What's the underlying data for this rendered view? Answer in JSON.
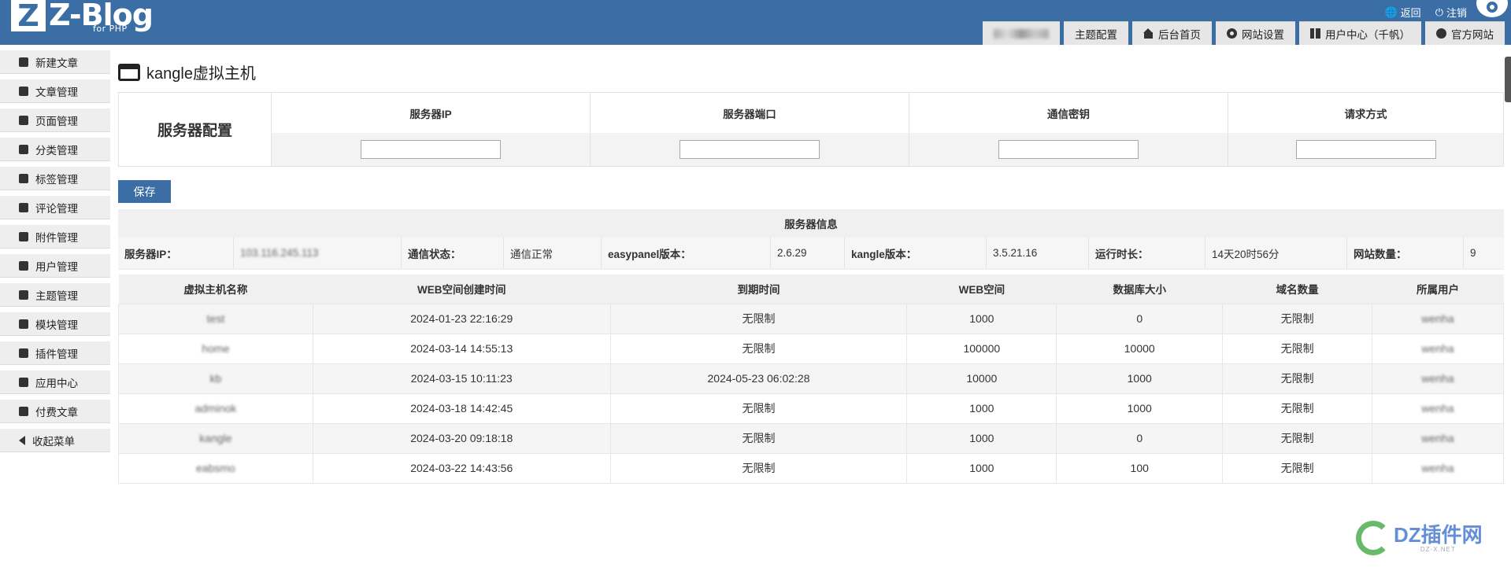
{
  "brand": {
    "logo_letter": "Z",
    "name": "Z-Blog",
    "sub": "for PHP"
  },
  "top_links": {
    "back": "返回",
    "logout": "注销"
  },
  "nav_tabs": [
    "主题配置",
    "后台首页",
    "网站设置",
    "用户中心（千帆）",
    "官方网站"
  ],
  "sidebar": [
    "新建文章",
    "文章管理",
    "页面管理",
    "分类管理",
    "标签管理",
    "评论管理",
    "附件管理",
    "用户管理",
    "主题管理",
    "模块管理",
    "插件管理",
    "应用中心",
    "付费文章",
    "收起菜单"
  ],
  "page_title": "kangle虚拟主机",
  "config": {
    "label": "服务器配置",
    "columns": [
      "服务器IP",
      "服务器端口",
      "通信密钥",
      "请求方式"
    ],
    "values": [
      "",
      "",
      "",
      ""
    ]
  },
  "save_label": "保存",
  "server_info": {
    "title": "服务器信息",
    "items": [
      {
        "k": "服务器IP：",
        "v": "103.116.245.113"
      },
      {
        "k": "通信状态：",
        "v": "通信正常"
      },
      {
        "k": "easypanel版本：",
        "v": "2.6.29"
      },
      {
        "k": "kangle版本：",
        "v": "3.5.21.16"
      },
      {
        "k": "运行时长：",
        "v": "14天20时56分"
      },
      {
        "k": "网站数量：",
        "v": "9"
      }
    ]
  },
  "hosts_table": {
    "headers": [
      "虚拟主机名称",
      "WEB空间创建时间",
      "到期时间",
      "WEB空间",
      "数据库大小",
      "域名数量",
      "所属用户"
    ],
    "rows": [
      [
        "test",
        "2024-01-23 22:16:29",
        "无限制",
        "1000",
        "0",
        "无限制",
        "wenha"
      ],
      [
        "home",
        "2024-03-14 14:55:13",
        "无限制",
        "100000",
        "10000",
        "无限制",
        "wenha"
      ],
      [
        "kb",
        "2024-03-15 10:11:23",
        "2024-05-23 06:02:28",
        "10000",
        "1000",
        "无限制",
        "wenha"
      ],
      [
        "adminok",
        "2024-03-18 14:42:45",
        "无限制",
        "1000",
        "1000",
        "无限制",
        "wenha"
      ],
      [
        "kangle",
        "2024-03-20 09:18:18",
        "无限制",
        "1000",
        "0",
        "无限制",
        "wenha"
      ],
      [
        "eabsmo",
        "2024-03-22 14:43:56",
        "无限制",
        "1000",
        "100",
        "无限制",
        "wenha"
      ]
    ]
  },
  "watermark": {
    "main": "DZ插件网",
    "sub": "DZ-X.NET"
  },
  "colors": {
    "brand": "#3a6ea5",
    "tab_bg": "#e6e6e6",
    "sidebar_bg": "#eeeeee"
  }
}
